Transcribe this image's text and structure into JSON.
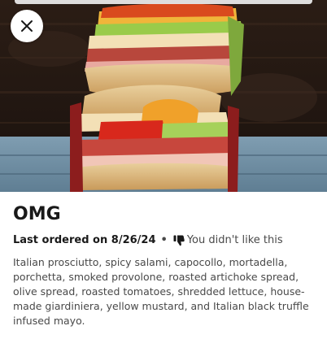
{
  "item": {
    "title": "OMG",
    "last_ordered": "Last ordered on 8/26/24",
    "separator": "•",
    "feedback": "You didn't like this",
    "description": "Italian prosciutto, spicy salami, capocollo, mortadella, porchetta, smoked provolone, roasted artichoke spread, olive spread, roasted tomatoes, shredded lettuce, house-made giardiniera, yellow mustard, and Italian black truffle infused mayo."
  },
  "icons": {
    "close": "close-icon",
    "feedback": "thumbs-down-icon"
  },
  "colors": {
    "text_primary": "#191919",
    "text_secondary": "#494949",
    "background": "#ffffff"
  }
}
